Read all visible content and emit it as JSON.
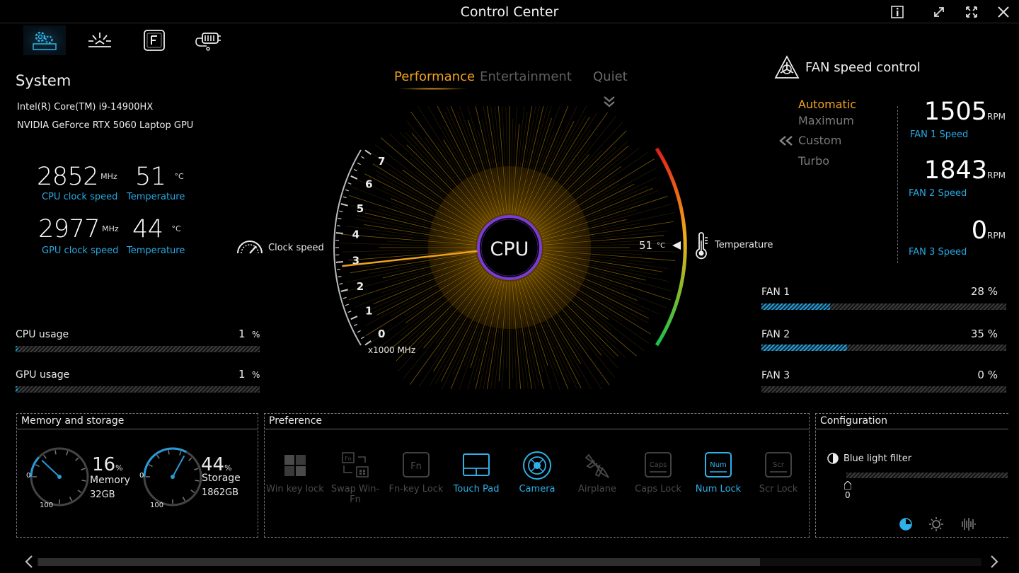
{
  "window": {
    "title": "Control Center"
  },
  "tabs": [
    {
      "icon": "system-settings-icon",
      "active": true
    },
    {
      "icon": "lighting-icon",
      "active": false
    },
    {
      "icon": "function-key-icon",
      "active": false
    },
    {
      "icon": "power-plug-icon",
      "active": false
    }
  ],
  "system": {
    "title": "System",
    "cpu_name": "Intel(R) Core(TM) i9-14900HX",
    "gpu_name": "NVIDIA GeForce RTX 5060 Laptop GPU",
    "cpu_clock": {
      "value": "2852",
      "unit": "MHz",
      "caption": "CPU clock speed"
    },
    "cpu_temp": {
      "value": "51",
      "unit": "°C",
      "caption": "Temperature"
    },
    "gpu_clock": {
      "value": "2977",
      "unit": "MHz",
      "caption": "GPU clock speed"
    },
    "gpu_temp": {
      "value": "44",
      "unit": "°C",
      "caption": "Temperature"
    }
  },
  "usage": {
    "cpu": {
      "label": "CPU usage",
      "value": "1",
      "unit": "%",
      "fraction": 0.01
    },
    "gpu": {
      "label": "GPU usage",
      "value": "1",
      "unit": "%",
      "fraction": 0.01
    }
  },
  "modes": {
    "performance": "Performance",
    "entertainment": "Entertainment",
    "quiet": "Quiet",
    "active": "Performance"
  },
  "gauge": {
    "center_label": "CPU",
    "clock_label": "Clock speed",
    "unit_label": "x1000 MHz",
    "ticks": [
      "0",
      "1",
      "2",
      "3",
      "4",
      "5",
      "6",
      "7"
    ],
    "needle_value_ghz": 2.852,
    "temp_value": "51",
    "temp_unit": "°C",
    "temp_label": "Temperature",
    "temp_fraction": 0.51
  },
  "fan_control": {
    "title": "FAN speed control",
    "modes": [
      "Automatic",
      "Maximum",
      "Custom",
      "Turbo"
    ],
    "active_mode": "Automatic",
    "fans": [
      {
        "rpm": "1505",
        "unit": "RPM",
        "caption": "FAN 1 Speed",
        "label": "FAN 1",
        "percent": "28 %",
        "fraction": 0.28
      },
      {
        "rpm": "1843",
        "unit": "RPM",
        "caption": "FAN 2 Speed",
        "label": "FAN 2",
        "percent": "35 %",
        "fraction": 0.35
      },
      {
        "rpm": "0",
        "unit": "RPM",
        "caption": "FAN 3 Speed",
        "label": "FAN 3",
        "percent": "0 %",
        "fraction": 0
      }
    ]
  },
  "memory": {
    "title": "Memory and storage",
    "mem": {
      "percent": "16",
      "unit": "%",
      "label": "Memory",
      "size": "32GB",
      "fraction": 0.16,
      "min": "0",
      "max": "100"
    },
    "storage": {
      "percent": "44",
      "unit": "%",
      "label": "Storage",
      "size": "1862GB",
      "fraction": 0.44,
      "min": "0",
      "max": "100"
    }
  },
  "preference": {
    "title": "Preference",
    "items": [
      {
        "label": "Win key lock",
        "icon": "windows-key-icon",
        "on": false
      },
      {
        "label": "Swap Win-Fn",
        "icon": "swap-keys-icon",
        "on": false
      },
      {
        "label": "Fn-key Lock",
        "icon": "fn-key-icon",
        "on": false
      },
      {
        "label": "Touch Pad",
        "icon": "touchpad-icon",
        "on": true
      },
      {
        "label": "Camera",
        "icon": "camera-icon",
        "on": true
      },
      {
        "label": "Airplane",
        "icon": "airplane-icon",
        "on": false
      },
      {
        "label": "Caps Lock",
        "icon": "caps-lock-icon",
        "on": false
      },
      {
        "label": "Num Lock",
        "icon": "num-lock-icon",
        "on": true
      },
      {
        "label": "Scr Lock",
        "icon": "scroll-lock-icon",
        "on": false
      }
    ],
    "key_text": {
      "fn": "Fn",
      "caps": "Caps",
      "num": "Num",
      "scr": "Scr"
    }
  },
  "configuration": {
    "title": "Configuration",
    "blue_light_label": "Blue light filter",
    "blue_light_value": "0",
    "blue_light_fraction": 0
  }
}
